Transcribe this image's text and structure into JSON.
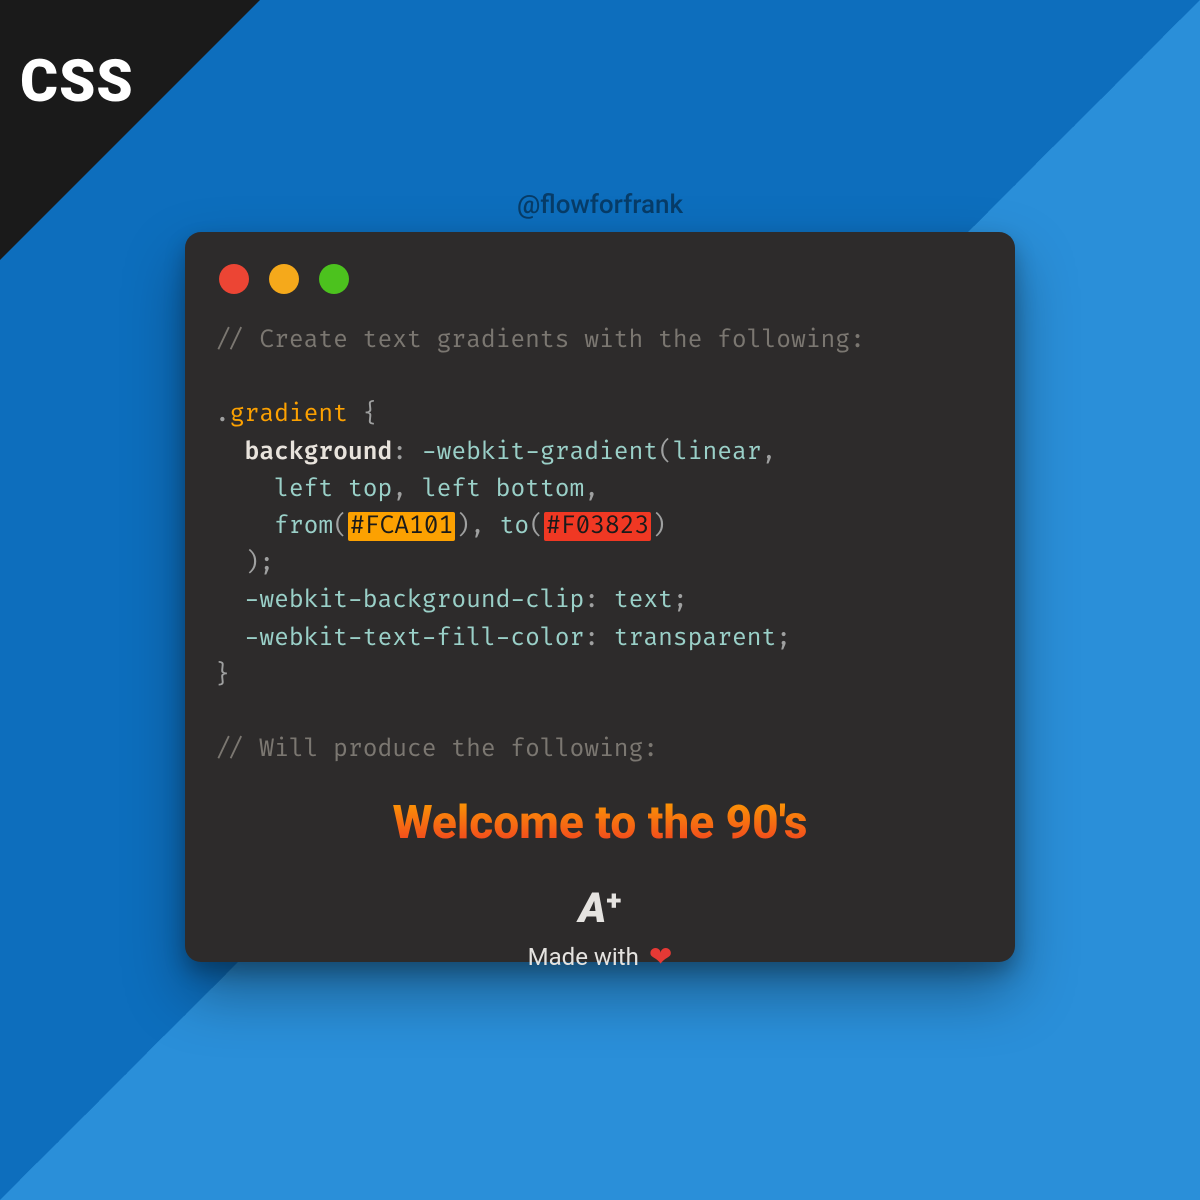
{
  "badge": "CSS",
  "handle": "@flowforfrank",
  "code": {
    "comment1": "// Create text gradients with the following:",
    "selector": ".gradient",
    "prop_bg": "background",
    "fn_webkit_gradient": "-webkit-gradient",
    "kw_linear": "linear",
    "kw_left_top": "left top",
    "kw_left_bottom": "left bottom",
    "fn_from": "from",
    "color_from": "#FCA101",
    "fn_to": "to",
    "color_to": "#F03823",
    "prop_clip": "-webkit-background-clip",
    "val_text": "text",
    "prop_fill": "-webkit-text-fill-color",
    "val_transparent": "transparent",
    "comment2": "// Will produce the following:"
  },
  "demo_text": "Welcome to the 90's",
  "footer": {
    "logo_a": "A",
    "logo_plus": "+",
    "made_with": "Made with",
    "heart": "❤"
  },
  "colors": {
    "from": "#FCA101",
    "to": "#F03823",
    "bg_dark": "#2d2b2b",
    "bg_blue_a": "#0d6ebd",
    "bg_blue_b": "#2a8fd9"
  }
}
